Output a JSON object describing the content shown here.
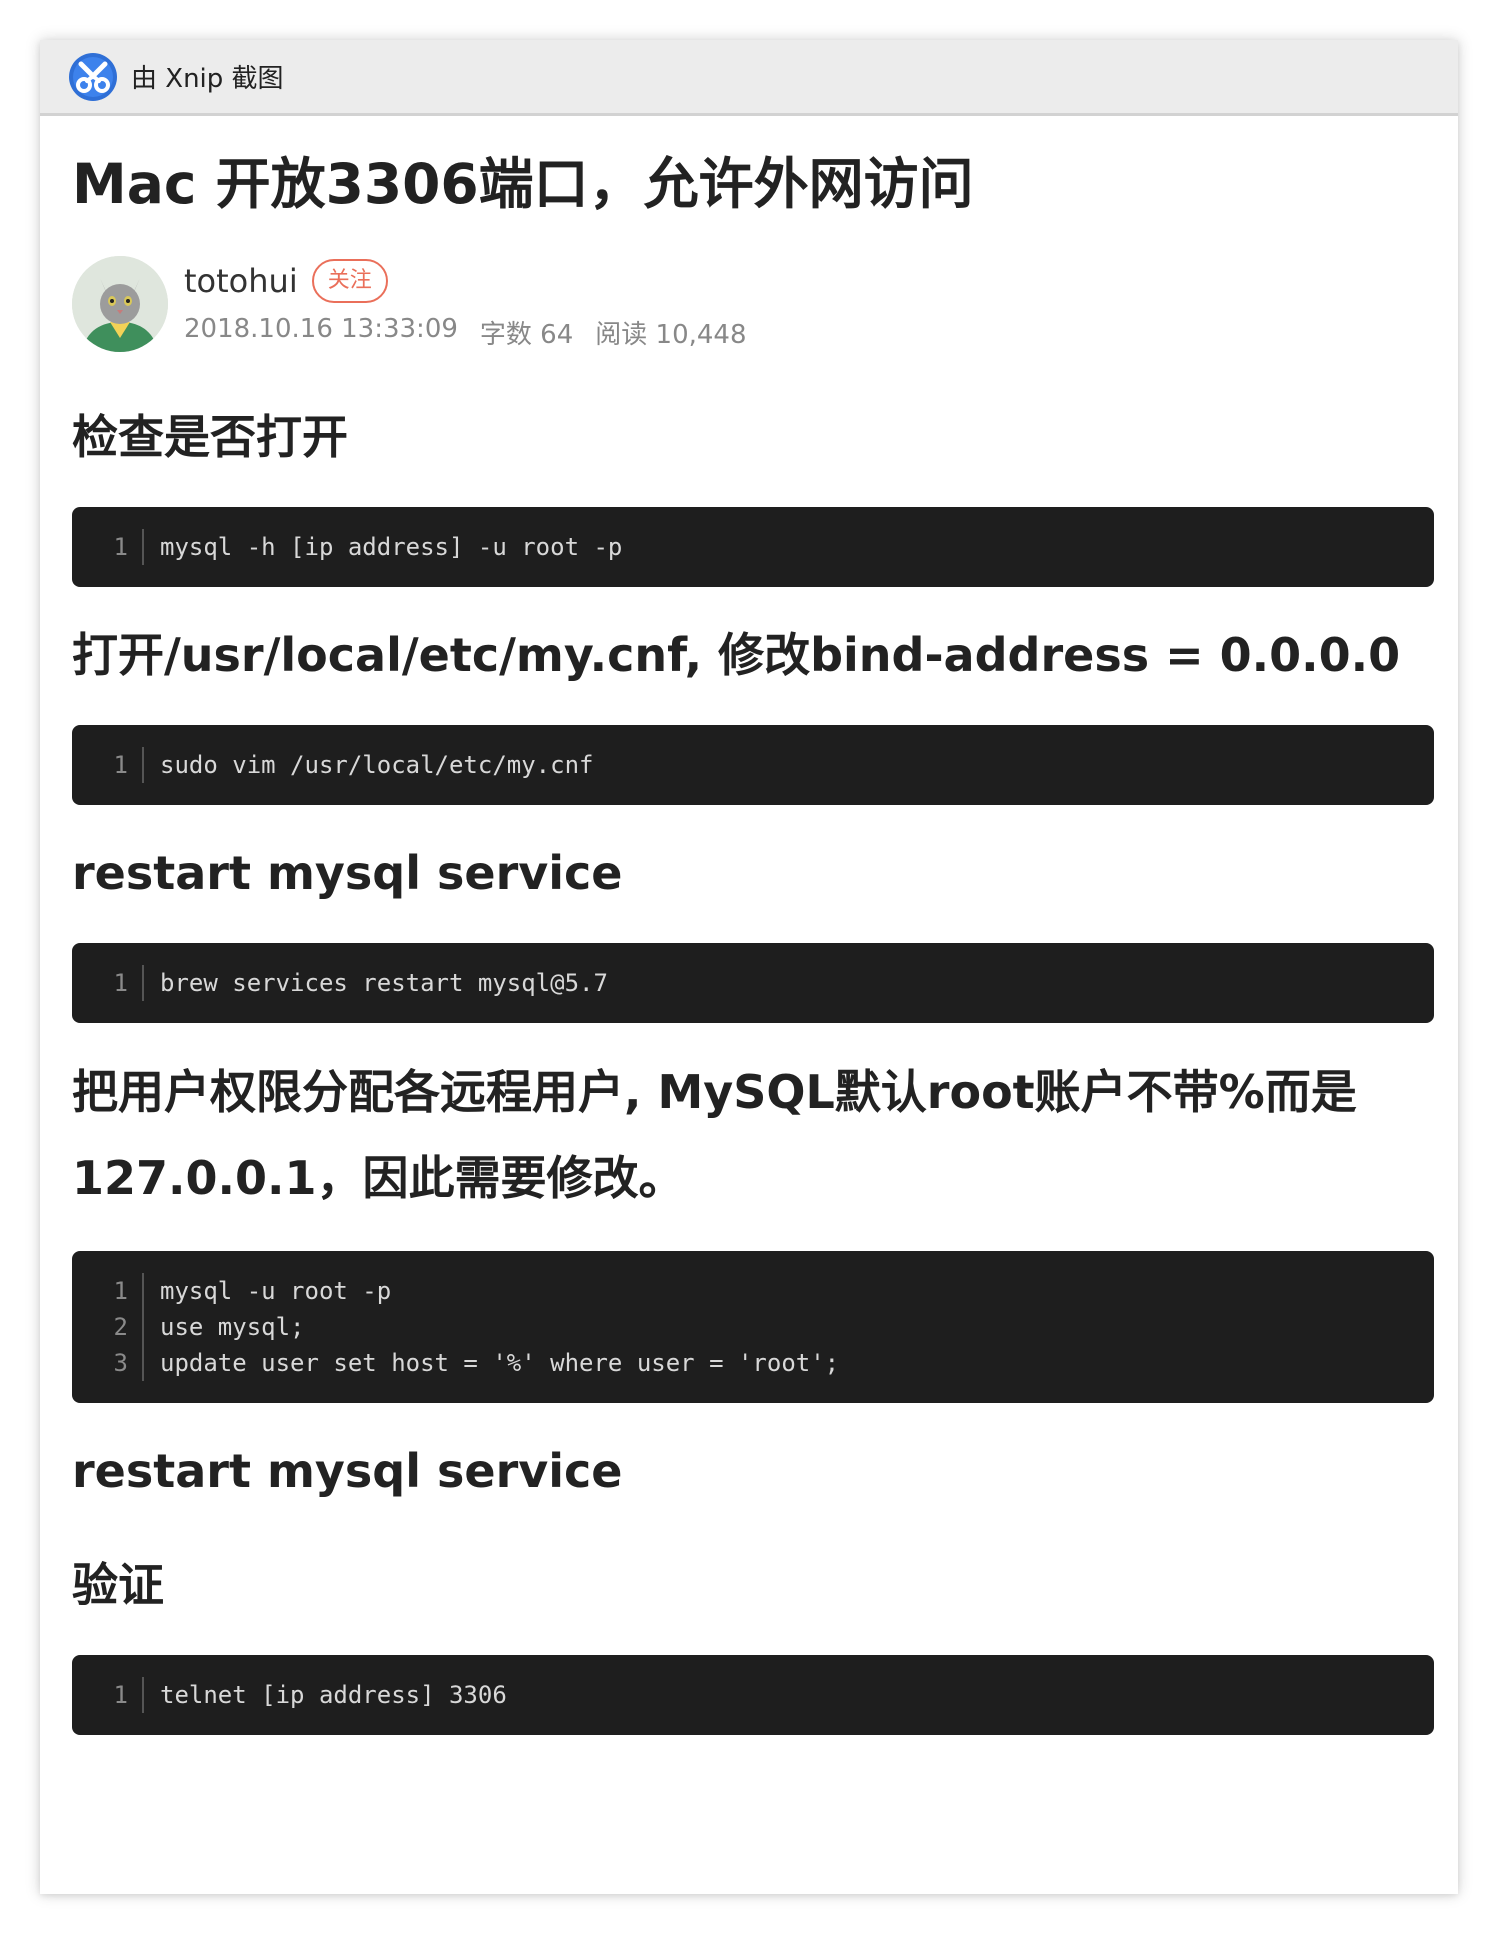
{
  "window": {
    "title": "由 Xnip 截图",
    "app_icon": "xnip-icon"
  },
  "post": {
    "title": "Mac 开放3306端口，允许外网访问",
    "author": {
      "name": "totohui",
      "follow_label": "关注",
      "date": "2018.10.16 13:33:09",
      "word_count": "字数 64",
      "reads": "阅读 10,448"
    }
  },
  "sections": [
    {
      "heading": "检查是否打开",
      "code": [
        {
          "n": "1",
          "text": "mysql -h [ip address] -u root -p"
        }
      ]
    },
    {
      "heading": "打开/usr/local/etc/my.cnf, 修改bind-address = 0.0.0.0",
      "code": [
        {
          "n": "1",
          "text": "sudo vim /usr/local/etc/my.cnf"
        }
      ]
    },
    {
      "heading": "restart mysql service",
      "code": [
        {
          "n": "1",
          "text": "brew services restart mysql@5.7"
        }
      ]
    },
    {
      "heading_line1": "把用户权限分配各远程用户, MySQL默认root账户不带%而是",
      "heading_line2": "127.0.0.1，因此需要修改。",
      "code": [
        {
          "n": "1",
          "text": "mysql -u root -p"
        },
        {
          "n": "2",
          "text": "use mysql;"
        },
        {
          "n": "3",
          "text": "update user set host = '%' where user = 'root';"
        }
      ]
    },
    {
      "heading": "restart mysql service"
    },
    {
      "heading": "验证",
      "code": [
        {
          "n": "1",
          "text": "telnet [ip address] 3306"
        }
      ]
    }
  ]
}
